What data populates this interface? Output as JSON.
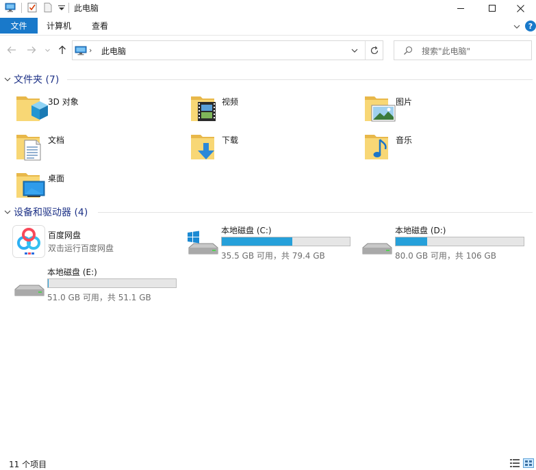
{
  "titlebar": {
    "title": "此电脑"
  },
  "ribbon": {
    "file_tab": "文件",
    "tabs": [
      "计算机",
      "查看"
    ],
    "help": "?"
  },
  "nav": {
    "address_chevron": "›",
    "address_text": "此电脑",
    "search_placeholder": "搜索\"此电脑\""
  },
  "groups": {
    "folders": {
      "title": "文件夹 (7)",
      "items": [
        {
          "label": "3D 对象",
          "icon": "3d-objects-folder-icon"
        },
        {
          "label": "视频",
          "icon": "videos-folder-icon"
        },
        {
          "label": "图片",
          "icon": "pictures-folder-icon"
        },
        {
          "label": "文档",
          "icon": "documents-folder-icon"
        },
        {
          "label": "下载",
          "icon": "downloads-folder-icon"
        },
        {
          "label": "音乐",
          "icon": "music-folder-icon"
        },
        {
          "label": "桌面",
          "icon": "desktop-folder-icon"
        }
      ]
    },
    "devices": {
      "title": "设备和驱动器 (4)",
      "app": {
        "name": "百度网盘",
        "sub": "双击运行百度网盘",
        "icon": "baidu-netdisk-icon"
      },
      "drives": [
        {
          "name": "本地磁盘 (C:)",
          "free": "35.5 GB 可用，共 79.4 GB",
          "used_fraction": 0.553,
          "icon": "windows-drive-icon"
        },
        {
          "name": "本地磁盘 (D:)",
          "free": "80.0 GB 可用，共 106 GB",
          "used_fraction": 0.245,
          "icon": "hard-drive-icon"
        },
        {
          "name": "本地磁盘 (E:)",
          "free": "51.0 GB 可用，共 51.1 GB",
          "used_fraction": 0.002,
          "icon": "hard-drive-icon"
        }
      ]
    }
  },
  "status": {
    "count": "11 个项目"
  },
  "colors": {
    "accent": "#1979ca",
    "drive_fill": "#26a0da",
    "group_title": "#1e3287",
    "folder_yellow": "#f8d775"
  }
}
